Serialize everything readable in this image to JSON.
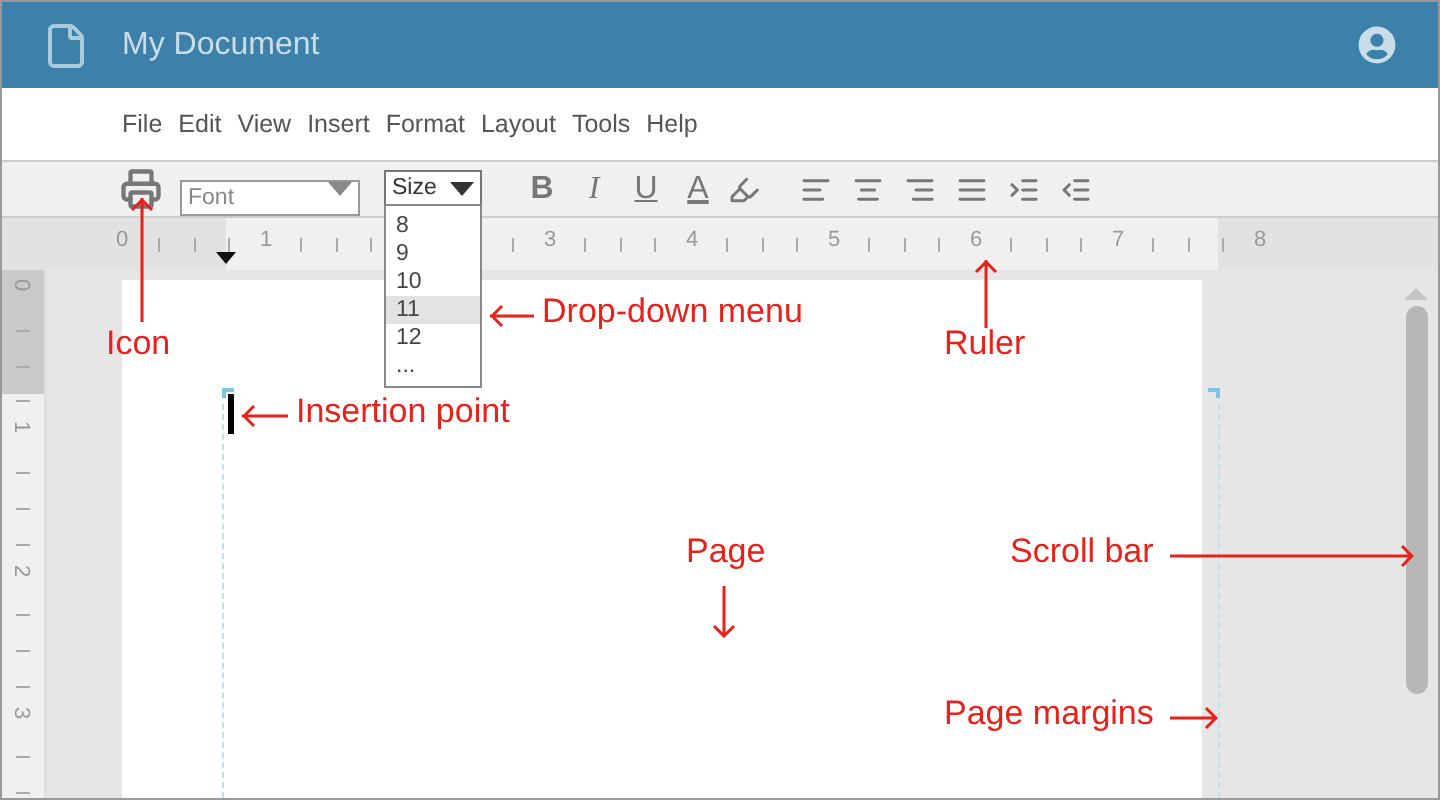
{
  "window": {
    "title": "My Document"
  },
  "menu": [
    "File",
    "Edit",
    "View",
    "Insert",
    "Format",
    "Layout",
    "Tools",
    "Help"
  ],
  "toolbar": {
    "font": {
      "placeholder": "Font"
    },
    "size": {
      "value": "Size",
      "expanded": true,
      "options": [
        {
          "label": "8",
          "selected": false
        },
        {
          "label": "9",
          "selected": false
        },
        {
          "label": "10",
          "selected": false
        },
        {
          "label": "11",
          "selected": true
        },
        {
          "label": "12",
          "selected": false
        },
        {
          "label": "...",
          "selected": false
        }
      ]
    },
    "format_buttons": [
      {
        "label": "B",
        "kind": "bold"
      },
      {
        "label": "I",
        "kind": "italic"
      },
      {
        "label": "U",
        "kind": "underline"
      },
      {
        "label": "A",
        "kind": "color"
      }
    ]
  },
  "ruler": [
    "0",
    "1",
    "3",
    "4",
    "5",
    "6",
    "7",
    "8"
  ],
  "vertical_ruler": [
    "0",
    "1",
    "2",
    "3"
  ],
  "annotations": [
    {
      "text": "Icon",
      "kind": "up"
    },
    {
      "text": "Drop-down menu",
      "kind": "left"
    },
    {
      "text": "Ruler",
      "kind": "up"
    },
    {
      "text": "Insertion point",
      "kind": "left"
    },
    {
      "text": "Page",
      "kind": "down"
    },
    {
      "text": "Scroll bar",
      "kind": "right"
    },
    {
      "text": "Page margins",
      "kind": "right"
    }
  ]
}
